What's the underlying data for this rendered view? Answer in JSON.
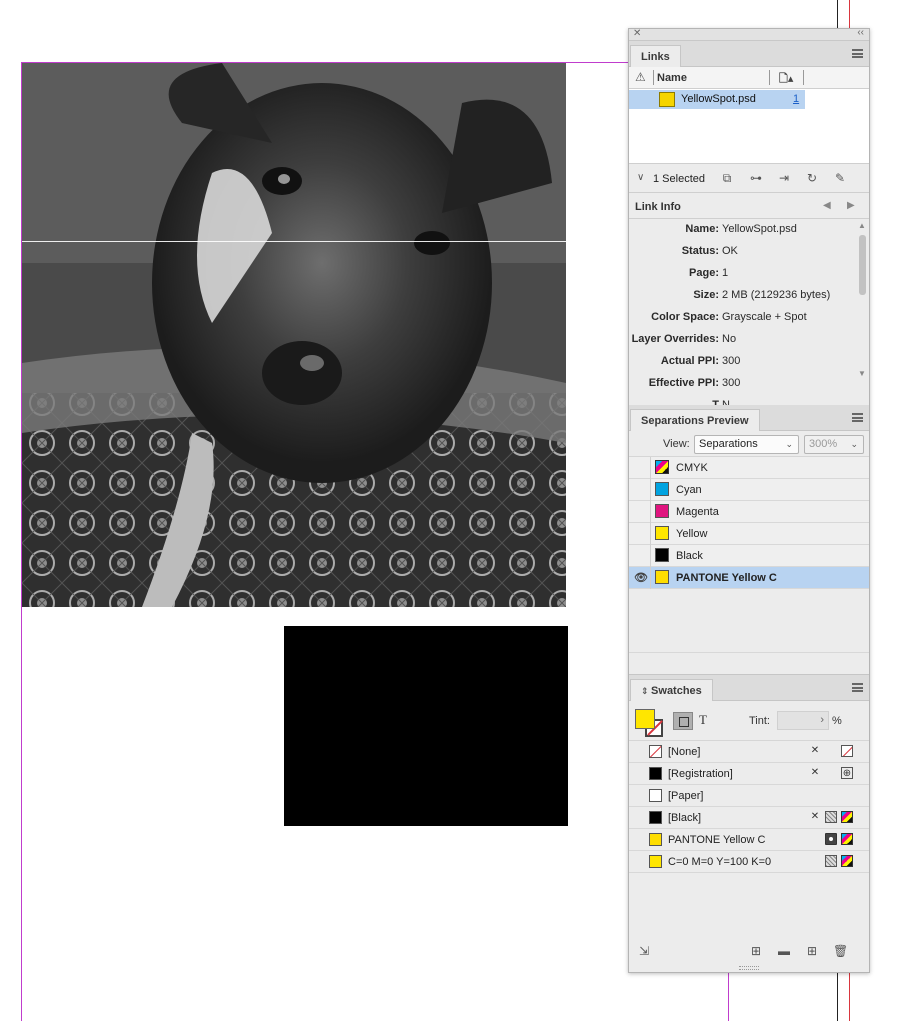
{
  "colors": {
    "accent_selected": "#b8d3f1",
    "guide_magenta": "#c03ccd",
    "guide_red": "#d9363e",
    "cyan": "#00a3e0",
    "magenta": "#e0157f",
    "yellow": "#ffe600",
    "black": "#000000",
    "pantone_yellow_c": "#fedd00"
  },
  "dock": {
    "close_icon": "close-icon",
    "collapse_icon": "collapse-icon"
  },
  "links": {
    "tab_label": "Links",
    "columns": {
      "name": "Name"
    },
    "rows": [
      {
        "name": "YellowSpot.psd",
        "page": "1",
        "thumb_color": "#f5d400"
      }
    ],
    "selected_count_label": "1 Selected",
    "toolbar_icons": [
      "relink-cc-icon",
      "relink-icon",
      "goto-link-icon",
      "update-link-icon",
      "edit-original-icon"
    ],
    "info_title": "Link Info",
    "info": [
      {
        "key": "Name:",
        "value": "YellowSpot.psd"
      },
      {
        "key": "Status:",
        "value": "OK"
      },
      {
        "key": "Page:",
        "value": "1"
      },
      {
        "key": "Size:",
        "value": "2 MB (2129236 bytes)"
      },
      {
        "key": "Color Space:",
        "value": "Grayscale + Spot"
      },
      {
        "key": "Layer Overrides:",
        "value": "No"
      },
      {
        "key": "Actual PPI:",
        "value": "300"
      },
      {
        "key": "Effective PPI:",
        "value": "300"
      },
      {
        "key": "T",
        "value": "N"
      }
    ]
  },
  "separations": {
    "tab_label": "Separations Preview",
    "view_label": "View:",
    "view_value": "Separations",
    "zoom_value": "300%",
    "rows": [
      {
        "name": "CMYK",
        "type": "cmyk",
        "visible": false,
        "selected": false
      },
      {
        "name": "Cyan",
        "type": "process",
        "color": "#00a3e0",
        "visible": false,
        "selected": false
      },
      {
        "name": "Magenta",
        "type": "process",
        "color": "#e0157f",
        "visible": false,
        "selected": false
      },
      {
        "name": "Yellow",
        "type": "process",
        "color": "#ffe600",
        "visible": false,
        "selected": false
      },
      {
        "name": "Black",
        "type": "process",
        "color": "#000000",
        "visible": false,
        "selected": false
      },
      {
        "name": "PANTONE Yellow C",
        "type": "spot",
        "color": "#fedd00",
        "visible": true,
        "selected": true
      }
    ]
  },
  "swatches": {
    "tab_label": "Swatches",
    "tint_label": "Tint:",
    "tint_value": "",
    "tint_unit": "%",
    "text_toggle": "T",
    "rows": [
      {
        "name": "[None]",
        "swatch": "none",
        "icons": [
          "locked-icon",
          "none-icon"
        ]
      },
      {
        "name": "[Registration]",
        "swatch": "#000000",
        "icons": [
          "locked-icon",
          "registration-icon"
        ]
      },
      {
        "name": "[Paper]",
        "swatch": "#ffffff",
        "icons": []
      },
      {
        "name": "[Black]",
        "swatch": "#000000",
        "icons": [
          "locked-icon",
          "process-icon",
          "cmyk-icon"
        ]
      },
      {
        "name": "PANTONE Yellow C",
        "swatch": "#fedd00",
        "icons": [
          "spot-icon",
          "cmyk-icon"
        ]
      },
      {
        "name": "C=0 M=0 Y=100 K=0",
        "swatch": "#ffe600",
        "icons": [
          "process-icon",
          "cmyk-icon"
        ]
      }
    ],
    "footer_icons": [
      "show-kinds-icon",
      "swatch-views-icon",
      "new-color-group-icon",
      "new-swatch-icon",
      "delete-swatch-icon"
    ]
  }
}
